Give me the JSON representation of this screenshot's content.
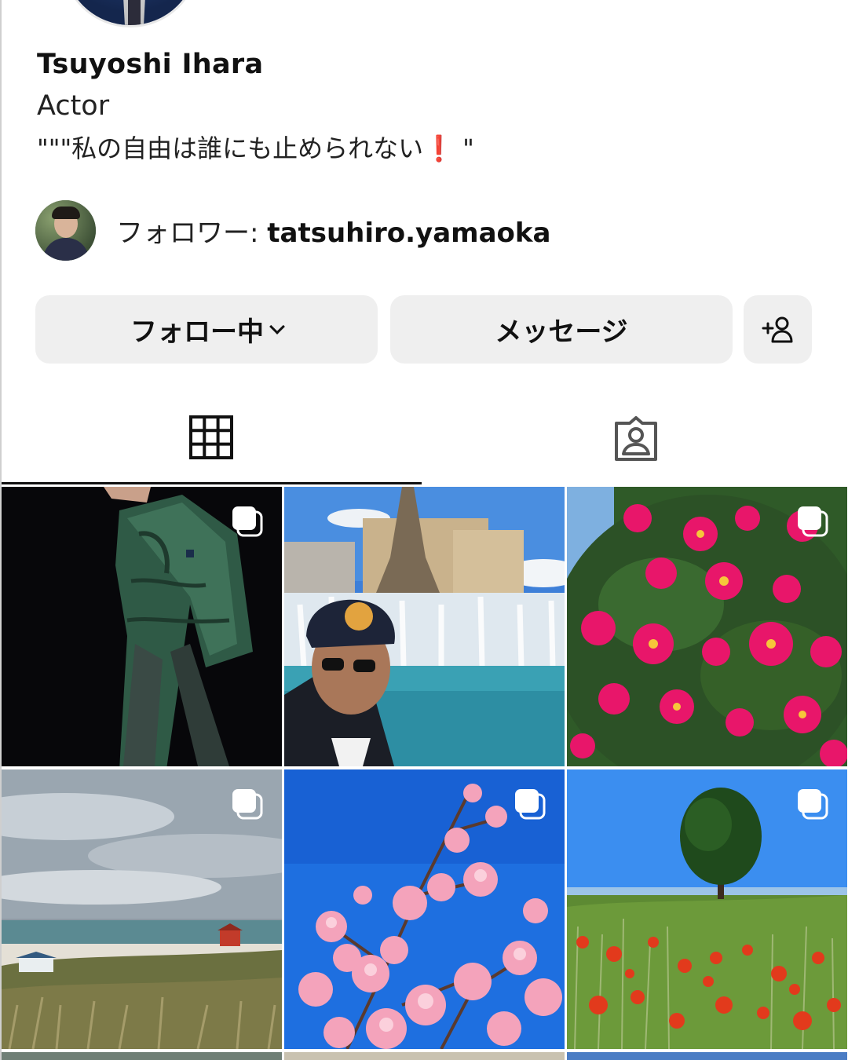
{
  "profile": {
    "name": "Tsuyoshi Ihara",
    "category": "Actor",
    "bio": "\"\"\"私の自由は誰にも止められない❗️ \""
  },
  "followed_by": {
    "prefix": "フォロワー: ",
    "handle": "tatsuhiro.yamaoka"
  },
  "actions": {
    "following_label": "フォロー中",
    "message_label": "メッセージ",
    "suggest_icon": "add-person-icon"
  },
  "tabs": [
    {
      "icon": "grid-icon",
      "active": true
    },
    {
      "icon": "tagged-person-icon",
      "active": false
    }
  ],
  "posts": [
    {
      "subject": "man in green puffer jacket",
      "multi": true
    },
    {
      "subject": "man in cap at Las Vegas fountains",
      "multi": false
    },
    {
      "subject": "pink camellia flowers",
      "multi": true
    },
    {
      "subject": "beach with dunes and lifeguard tower",
      "multi": true
    },
    {
      "subject": "pink cherry blossoms against blue sky",
      "multi": true
    },
    {
      "subject": "tree in field of red poppies",
      "multi": true
    }
  ],
  "colors": {
    "button_bg": "#efefef",
    "text": "#111111",
    "active_tab_underline": "#111111"
  }
}
